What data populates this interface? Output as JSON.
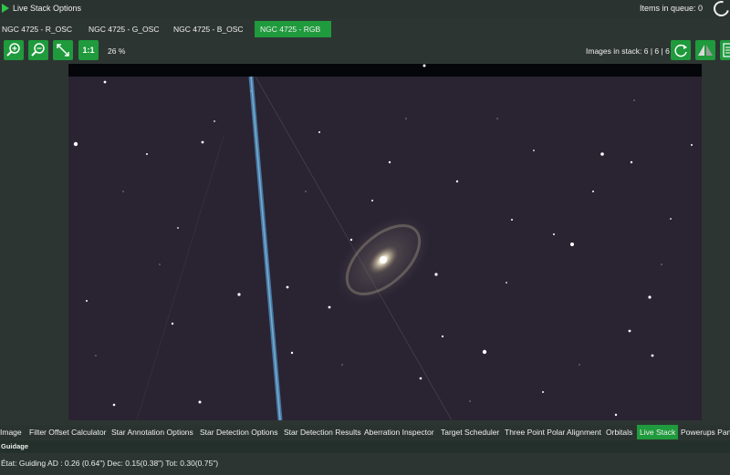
{
  "header": {
    "title": "Live Stack Options",
    "queue_text": "Items in queue: 0"
  },
  "tabs": [
    {
      "label": "NGC 4725 - R_OSC",
      "active": false
    },
    {
      "label": "NGC 4725 - G_OSC",
      "active": false
    },
    {
      "label": "NGC 4725 - B_OSC",
      "active": false
    },
    {
      "label": "NGC 4725 - RGB",
      "active": true
    }
  ],
  "toolbar": {
    "zoom_in_icon": "zoom-in-icon",
    "zoom_out_icon": "zoom-out-icon",
    "fit_icon": "fit-diagonal-icon",
    "one_to_one_label": "1:1",
    "zoom_level": "26 %",
    "images_in_stack": "Images in stack: 6 | 6 | 6",
    "refresh_icon": "refresh-icon",
    "flip_icon": "flip-icon",
    "save_icon": "save-icon",
    "accent": "#1f9a3c"
  },
  "bottom_tabs": [
    {
      "label": "Image",
      "active": false
    },
    {
      "label": "Filter Offset Calculator",
      "active": false
    },
    {
      "label": "Star Annotation Options",
      "active": false
    },
    {
      "label": "Star Detection Options",
      "active": false
    },
    {
      "label": "Star Detection Results",
      "active": false
    },
    {
      "label": "Aberration Inspector",
      "active": false
    },
    {
      "label": "Target Scheduler",
      "active": false
    },
    {
      "label": "Three Point Polar Alignment",
      "active": false
    },
    {
      "label": "Orbitals",
      "active": false
    },
    {
      "label": "Live Stack",
      "active": true
    },
    {
      "label": "Powerups Pane",
      "active": false
    }
  ],
  "guidage": {
    "label": "Guidage",
    "status": "État: Guiding  AD : 0.26 (0.64\")  Dec: 0.15(0.38\")  Tot: 0.30(0.75\")"
  }
}
